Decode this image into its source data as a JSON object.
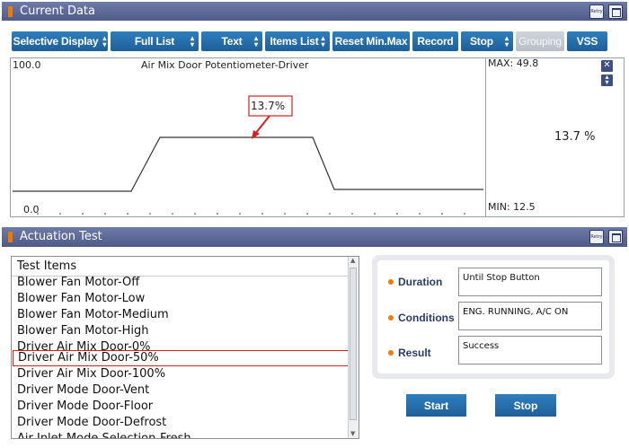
{
  "current_data": {
    "title": "Current Data",
    "retry_label": "Retry",
    "toolbar": {
      "selective_display": "Selective Display",
      "full_list": "Full List",
      "text": "Text",
      "items_list": "Items List",
      "reset_min_max": "Reset Min.Max",
      "record": "Record",
      "stop": "Stop",
      "grouping": "Grouping",
      "vss": "VSS"
    },
    "graph": {
      "y_max_label": "100.0",
      "y_min_label": "0.0",
      "signal_name": "Air Mix Door Potentiometer-Driver",
      "callout_value": "13.7%",
      "max_label": "MAX: 49.8",
      "min_label": "MIN: 12.5",
      "current_value": "13.7 %"
    }
  },
  "actuation_test": {
    "title": "Actuation Test",
    "retry_label": "Retry",
    "list_header": "Test Items",
    "items": [
      "Blower Fan Motor-Off",
      "Blower Fan Motor-Low",
      "Blower Fan Motor-Medium",
      "Blower Fan Motor-High",
      "Driver Air Mix Door-0%",
      "Driver Air Mix Door-50%",
      "Driver Air Mix Door-100%",
      "Driver Mode Door-Vent",
      "Driver Mode Door-Floor",
      "Driver Mode Door-Defrost",
      "Air Inlet Mode Selection-Fresh"
    ],
    "selected_index": 5,
    "details": {
      "duration_label": "Duration",
      "duration_value": "Until Stop Button",
      "conditions_label": "Conditions",
      "conditions_value": "ENG. RUNNING, A/C ON",
      "result_label": "Result",
      "result_value": "Success"
    },
    "start_label": "Start",
    "stop_label": "Stop"
  },
  "colors": {
    "title_bar": "#5a6694",
    "button_blue": "#2670ae",
    "accent_orange": "#f07a00",
    "selection_red": "#d42020"
  },
  "icons": [
    "retry-icon",
    "maximize-icon",
    "close-icon",
    "expand-icon",
    "spinner-arrows-icon",
    "bullet-dot-icon"
  ]
}
